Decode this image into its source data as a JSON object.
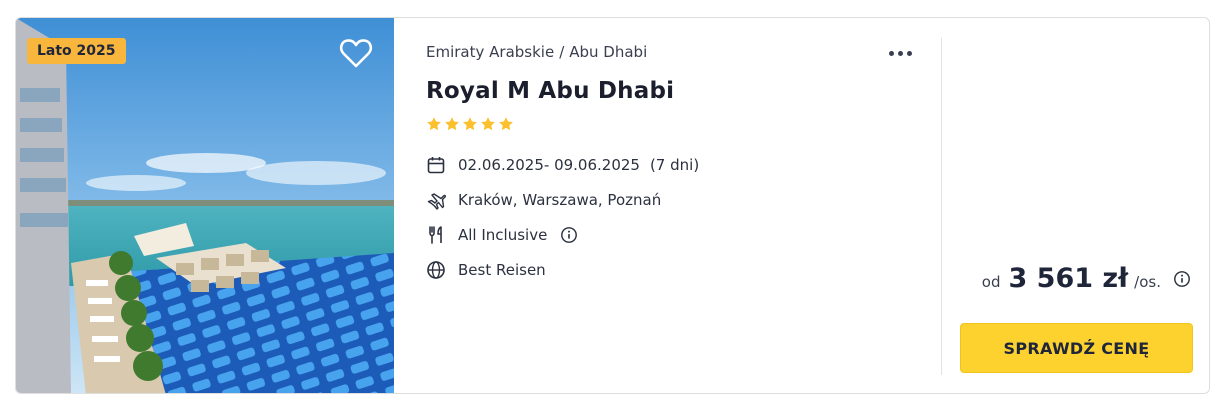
{
  "badge": "Lato 2025",
  "location": {
    "country": "Emiraty Arabskie",
    "separator": "/",
    "city": "Abu Dhabi"
  },
  "hotel": {
    "name": "Royal M Abu Dhabi",
    "stars": 5
  },
  "details": {
    "dates": "02.06.2025- 09.06.2025",
    "duration": "(7 dni)",
    "departures": "Kraków, Warszawa, Poznań",
    "board": "All Inclusive",
    "operator": "Best Reisen"
  },
  "price": {
    "prefix": "od",
    "value": "3 561 zł",
    "suffix": "/os."
  },
  "cta": "SPRAWDŹ CENĘ",
  "icons": {
    "favorite": "heart-outline-icon",
    "more": "more-dots-icon",
    "dates": "calendar-icon",
    "flight": "plane-icon",
    "board": "cutlery-icon",
    "info": "info-icon",
    "operator": "globe-icon",
    "star": "star-icon"
  },
  "colors": {
    "accent": "#fdd22f",
    "badge": "#f8b63c",
    "star": "#fbc02d",
    "text": "#20263a"
  }
}
